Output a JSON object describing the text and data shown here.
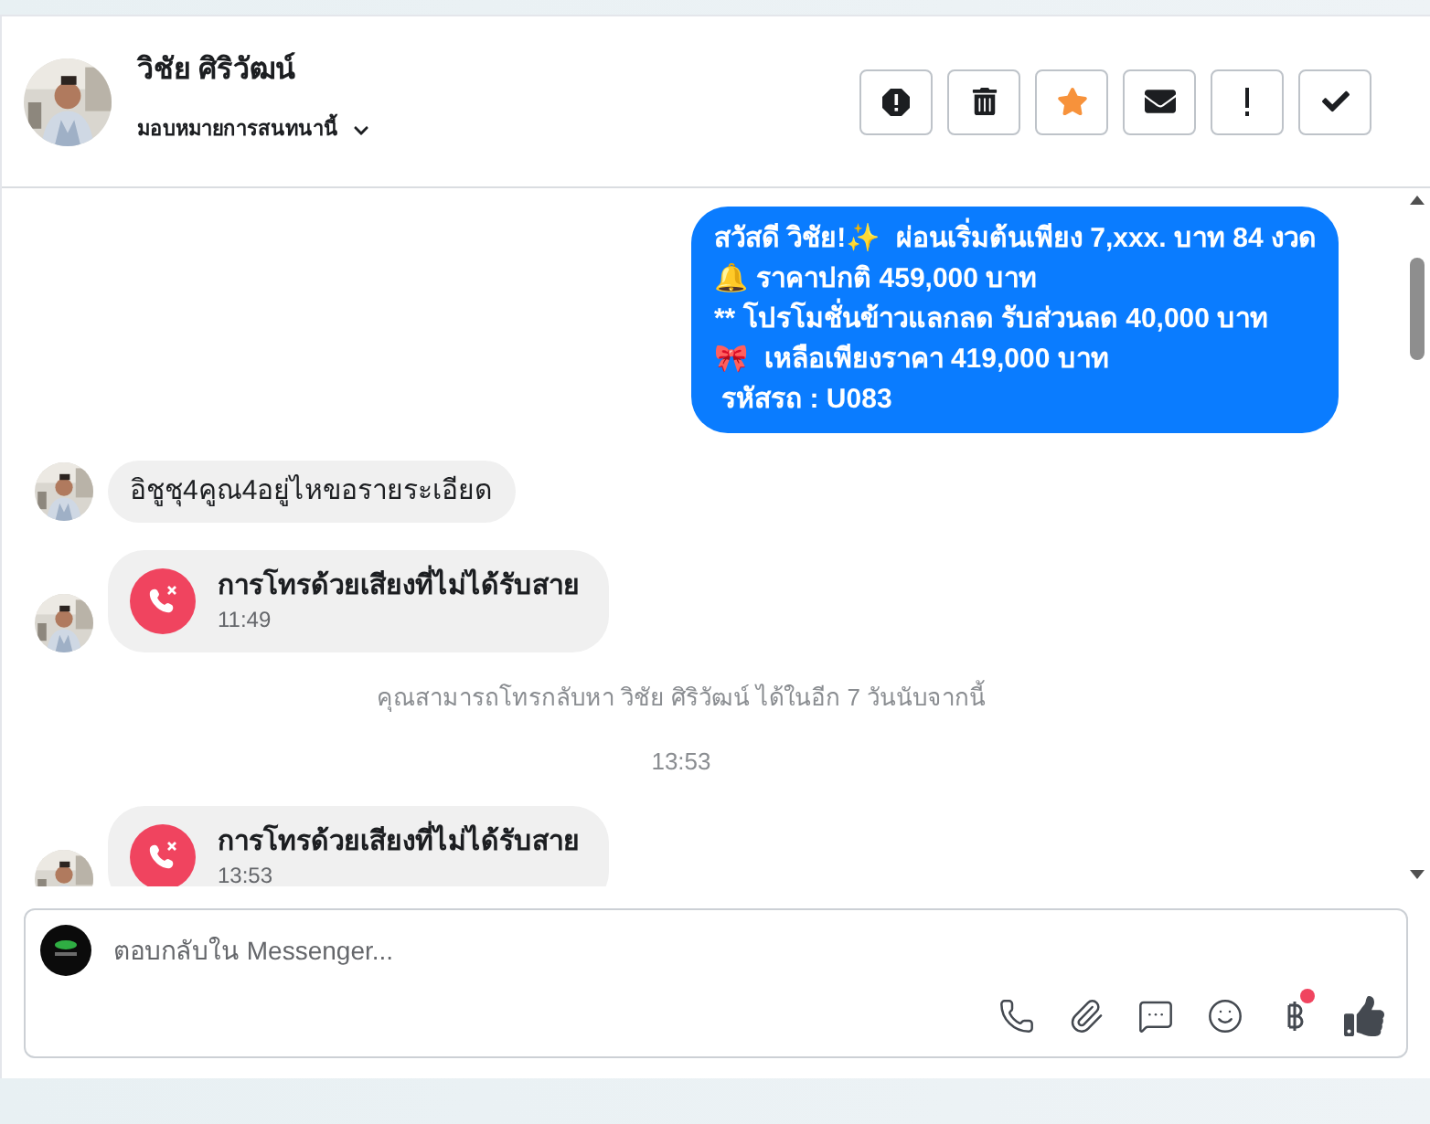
{
  "header": {
    "name": "วิชัย ศิริวัฒน์",
    "assign": "มอบหมายการสนทนานี้",
    "actions": [
      {
        "kind": "spam",
        "active": false
      },
      {
        "kind": "delete",
        "active": false
      },
      {
        "kind": "star",
        "active": true
      },
      {
        "kind": "unread",
        "active": false
      },
      {
        "kind": "important",
        "active": false
      },
      {
        "kind": "done",
        "active": false
      }
    ]
  },
  "messages": [
    {
      "kind": "outgoing",
      "lines": [
        "สวัสดี วิชัย!✨  ผ่อนเริ่มต้นเพียง 7,xxx. บาท 84 งวด",
        "🔔 ราคาปกติ 459,000 บาท",
        "** โปรโมชั่นข้าวแลกลด รับส่วนลด 40,000 บาท",
        "🎀  เหลือเพียงราคา 419,000 บาท",
        " รหัสรถ : U083"
      ]
    },
    {
      "kind": "incoming",
      "text": "อิชูชุ4คูณ4อยู่ไหขอรายระเอียด"
    },
    {
      "kind": "missed_call",
      "text": "การโทรด้วยเสียงที่ไม่ได้รับสาย",
      "time": "11:49"
    },
    {
      "kind": "notice",
      "text": "คุณสามารถโทรกลับหา วิชัย ศิริวัฒน์ ได้ในอีก 7 วันนับจากนี้"
    },
    {
      "kind": "timestamp",
      "text": "13:53"
    },
    {
      "kind": "missed_call",
      "text": "การโทรด้วยเสียงที่ไม่ได้รับสาย",
      "time": "13:53"
    }
  ],
  "composer": {
    "placeholder": "ตอบกลับใน Messenger...",
    "tools": [
      {
        "kind": "call",
        "badge": false
      },
      {
        "kind": "attach",
        "badge": false
      },
      {
        "kind": "saved_reply",
        "badge": false
      },
      {
        "kind": "emoji",
        "badge": false
      },
      {
        "kind": "payment",
        "badge": true
      },
      {
        "kind": "like",
        "badge": false
      }
    ]
  }
}
